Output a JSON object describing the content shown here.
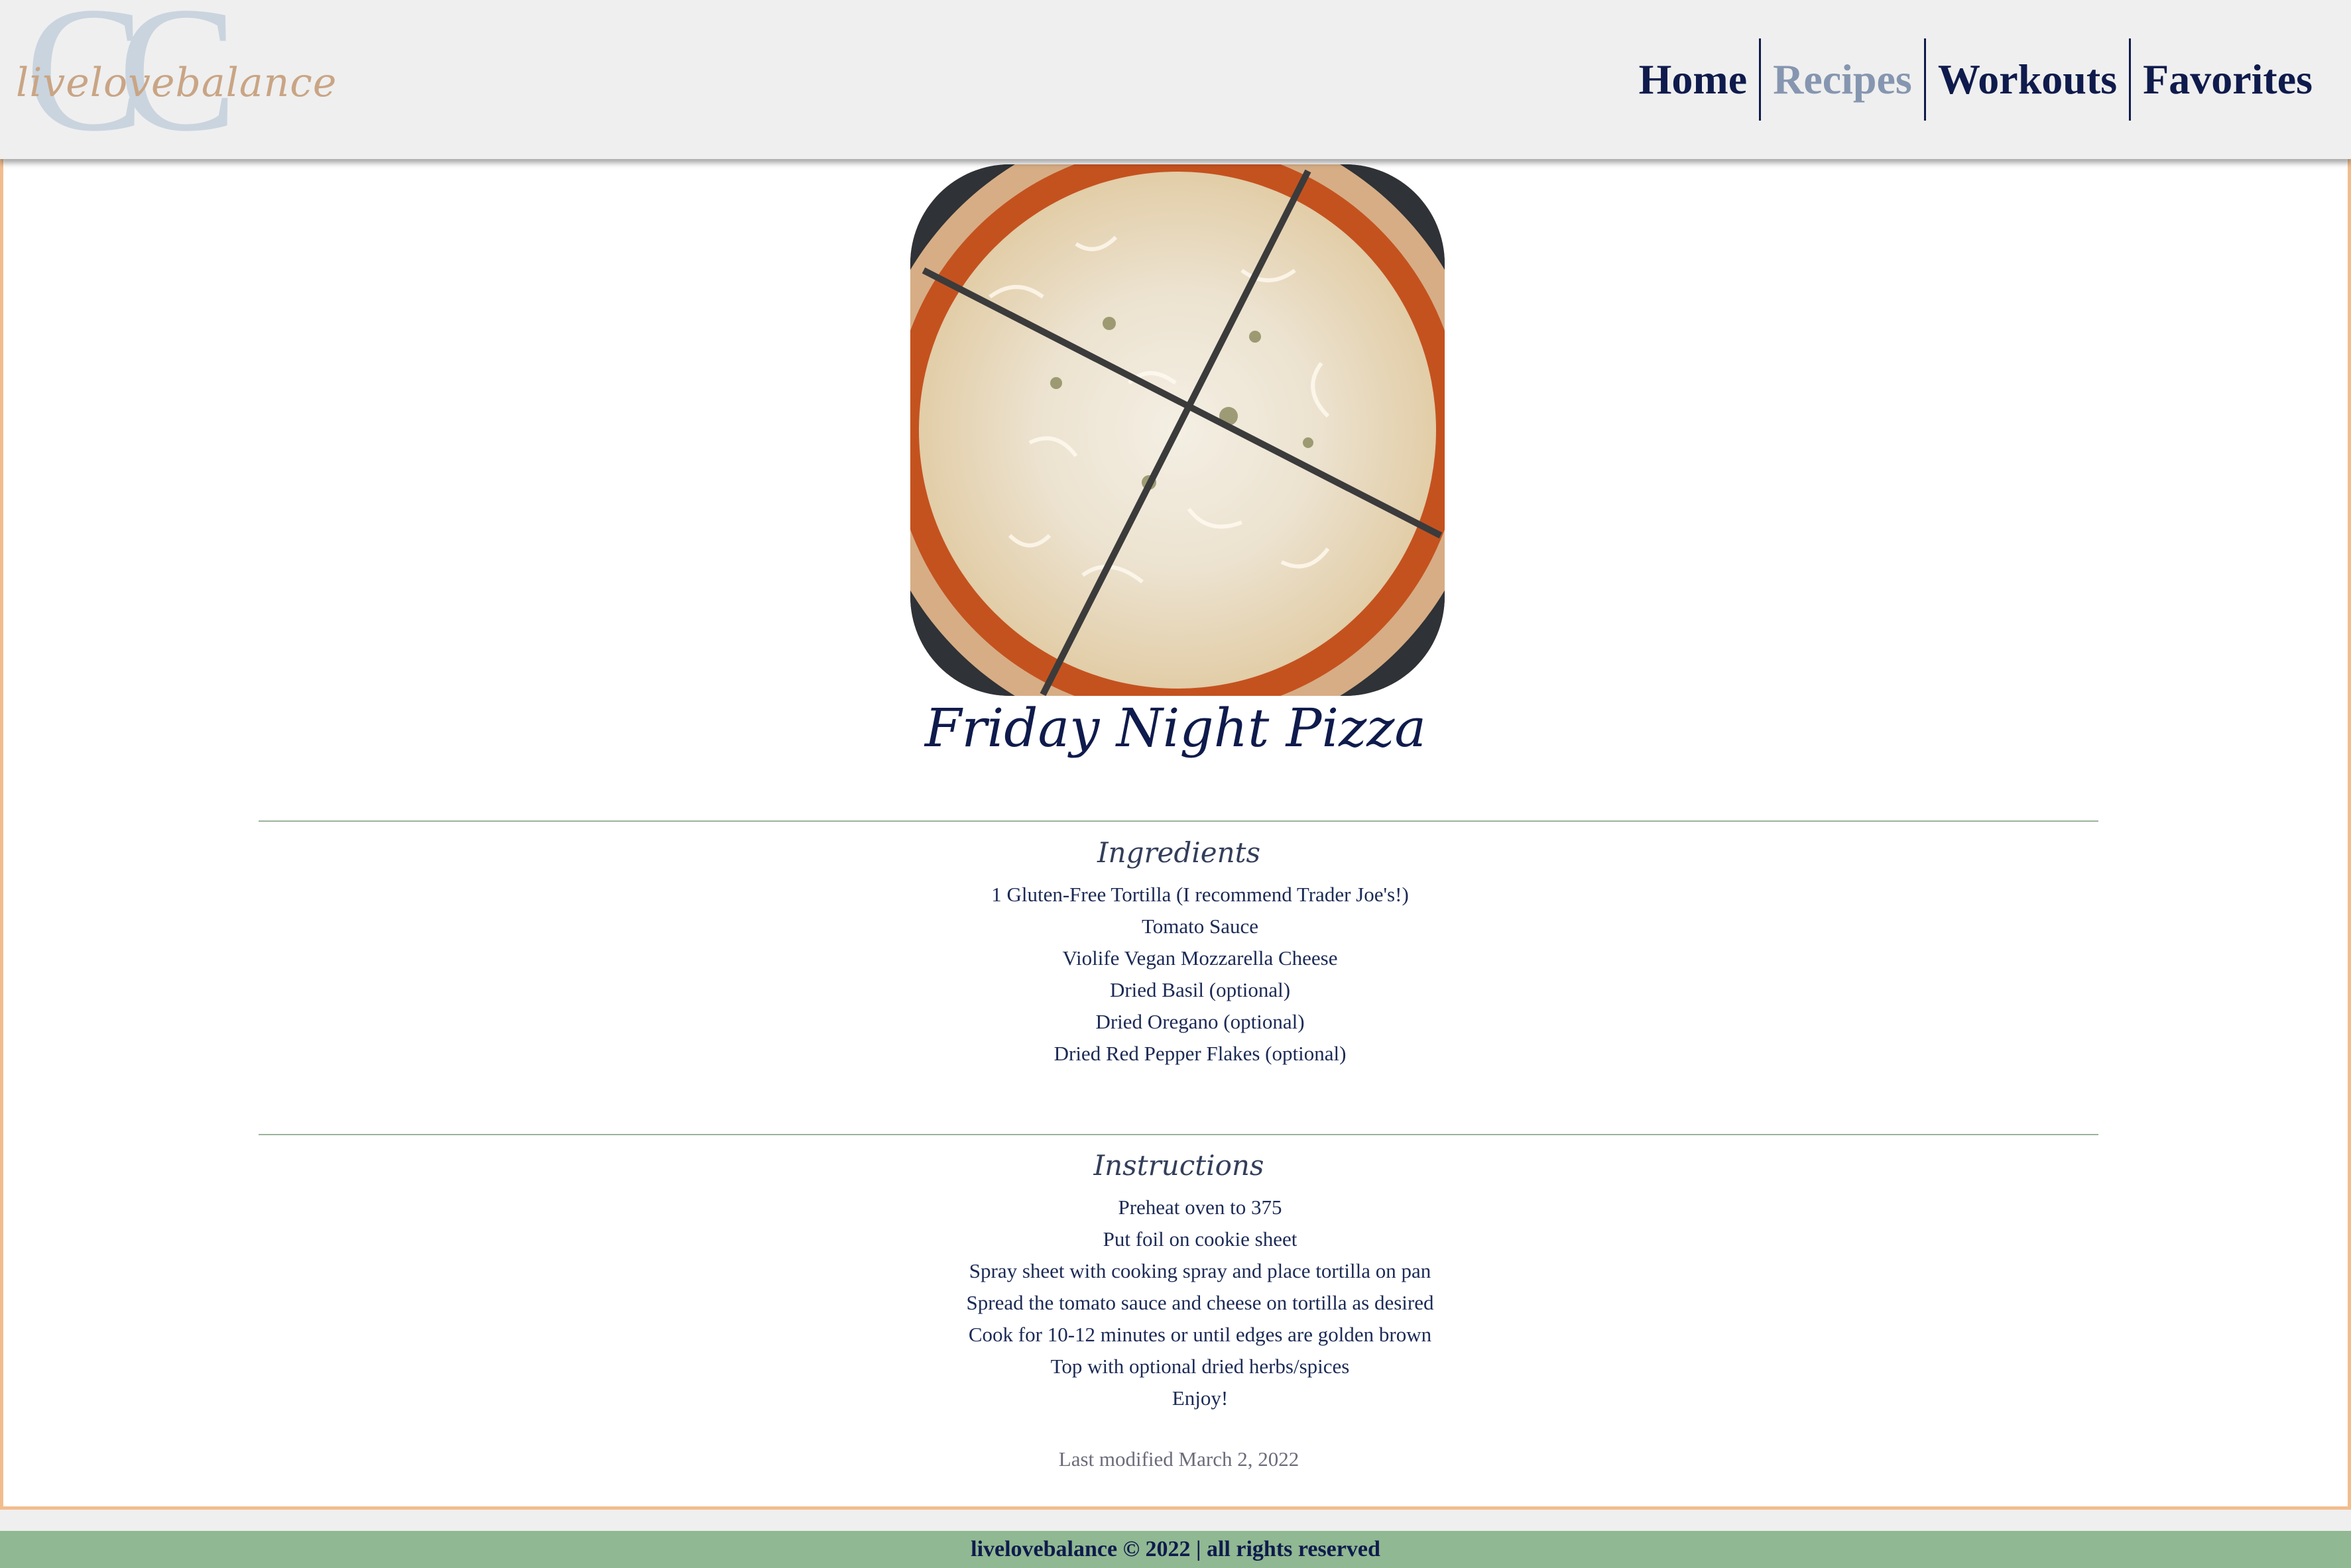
{
  "brand": {
    "monogram": "CC",
    "script_name": "livelovebalance"
  },
  "nav": {
    "items": [
      {
        "label": "Home",
        "active": false
      },
      {
        "label": "Recipes",
        "active": true
      },
      {
        "label": "Workouts",
        "active": false
      },
      {
        "label": "Favorites",
        "active": false
      }
    ]
  },
  "recipe": {
    "title": "Friday Night Pizza",
    "image_subject": "gluten-free tortilla pizza cut into four slices",
    "ingredients_heading": "Ingredients",
    "ingredients": [
      "1 Gluten-Free Tortilla (I recommend Trader Joe's!)",
      "Tomato Sauce",
      "Violife Vegan Mozzarella Cheese",
      "Dried Basil (optional)",
      "Dried Oregano (optional)",
      "Dried Red Pepper Flakes (optional)"
    ],
    "instructions_heading": "Instructions",
    "instructions": [
      "Preheat oven to 375",
      "Put foil on cookie sheet",
      "Spray sheet with cooking spray and place tortilla on pan",
      "Spread the tomato sauce and cheese on tortilla as desired",
      "Cook for 10-12 minutes or until edges are golden brown",
      "Top with optional dried herbs/spices",
      "Enjoy!"
    ],
    "last_modified": "Last modified March 2, 2022"
  },
  "footer": {
    "text": "livelovebalance © 2022 | all rights reserved"
  },
  "colors": {
    "navy": "#0f1b4c",
    "active_nav": "#8696b0",
    "frame_orange": "#f2bd8e",
    "footer_green": "#90b892",
    "divider_green": "#9bb39b"
  }
}
